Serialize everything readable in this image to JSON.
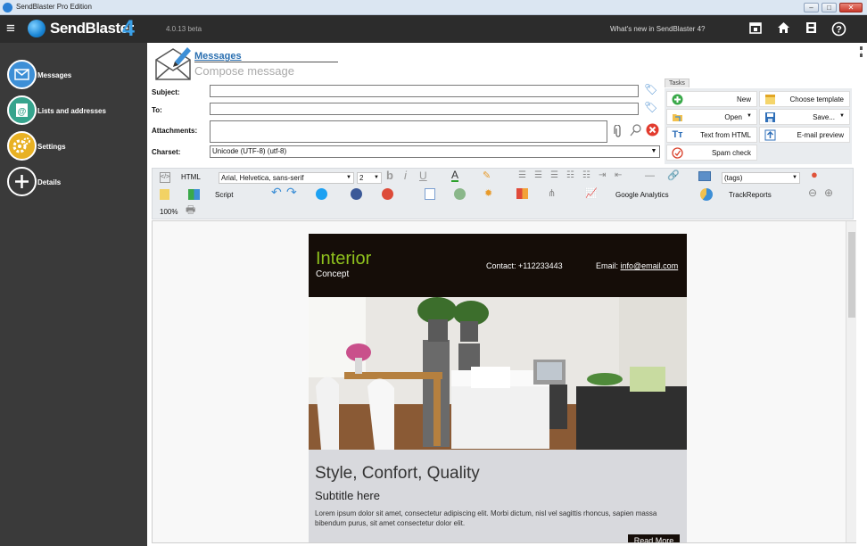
{
  "window": {
    "title": "SendBlaster Pro Edition",
    "min_glyph": "–",
    "max_glyph": "□",
    "close_glyph": "✕"
  },
  "header": {
    "logo_text": "SendBlaster",
    "logo_num": "4",
    "version": "4.0.13 beta",
    "whats_new": "What's new in SendBlaster 4?",
    "icons": [
      "calendar-icon",
      "home-icon",
      "film-icon",
      "help-icon"
    ]
  },
  "sidebar": {
    "items": [
      {
        "label": "Messages",
        "icon": "envelope-icon",
        "color": "#3d8fd6"
      },
      {
        "label": "Lists and addresses",
        "icon": "at-icon",
        "color": "#36a48d"
      },
      {
        "label": "Settings",
        "icon": "gear-icon",
        "color": "#e8b123"
      },
      {
        "label": "Details",
        "icon": "plus-circle-icon",
        "color": "#3a3a3a"
      }
    ]
  },
  "page": {
    "breadcrumb": "Messages",
    "subtitle": "Compose message"
  },
  "form": {
    "subject_label": "Subject:",
    "to_label": "To:",
    "attachments_label": "Attachments:",
    "charset_label": "Charset:",
    "charset_value": "Unicode (UTF-8)      (utf-8)",
    "subject_value": "",
    "to_value": ""
  },
  "tasks": {
    "label": "Tasks",
    "buttons": [
      {
        "label": "New",
        "icon": "plus-icon"
      },
      {
        "label": "Choose template",
        "icon": "template-icon"
      },
      {
        "label": "Open",
        "icon": "folder-open-icon",
        "has_menu": true
      },
      {
        "label": "Save...",
        "icon": "floppy-icon",
        "has_menu": true
      },
      {
        "label": "Text from HTML",
        "icon": "text-icon"
      },
      {
        "label": "E-mail preview",
        "icon": "preview-icon"
      },
      {
        "label": "Spam check",
        "icon": "spam-check-icon"
      }
    ]
  },
  "toolbar": {
    "html_label": "HTML",
    "font_value": "Arial, Helvetica, sans-serif",
    "size_value": "2",
    "tags_value": "(tags)",
    "script_label": "Script",
    "ga_label": "Google Analytics",
    "tr_label": "TrackReports",
    "zoom": "100%"
  },
  "email": {
    "brand": "Interior",
    "brand_sub": "Concept",
    "contact": "Contact: +112233443",
    "email_label": "Email:",
    "email_link": "info@email.com",
    "headline": "Style, Confort, Quality",
    "subtitle": "Subtitle here",
    "paragraph": "Lorem ipsum dolor sit amet, consectetur adipiscing elit. Morbi dictum, nisl vel sagittis rhoncus, sapien massa bibendum purus, sit amet consectetur dolor elit.",
    "read_more": "Read More"
  },
  "colors": {
    "accent": "#2a6fb0",
    "brand_green": "#8fc21d",
    "header_bg": "#2c2c2c",
    "sidebar_bg": "#3a3a3a"
  }
}
